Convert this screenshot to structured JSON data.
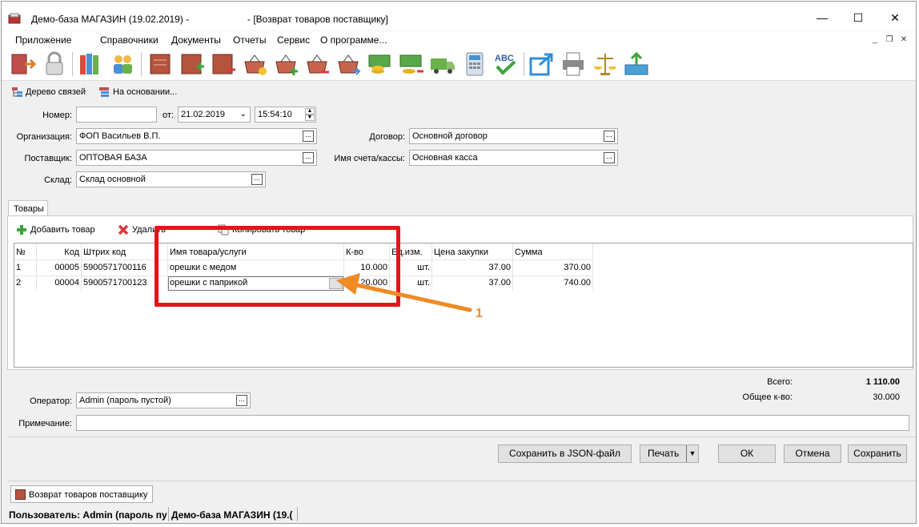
{
  "titlebar": {
    "app_title": "Демо-база МАГАЗИН (19.02.2019) -",
    "doc_title": "- [Возврат товаров поставщику]"
  },
  "menu": [
    "Приложение",
    "Справочники",
    "Документы",
    "Отчеты",
    "Сервис",
    "О программе..."
  ],
  "doc_toolbar": {
    "tree_label": "Дерево связей",
    "based_label": "На основании..."
  },
  "form": {
    "number_label": "Номер:",
    "number_value": "",
    "from_label": "от:",
    "date_value": "21.02.2019",
    "time_value": "15:54:10",
    "org_label": "Организация:",
    "org_value": "ФОП Васильев В.П.",
    "supplier_label": "Поставщик:",
    "supplier_value": "ОПТОВАЯ БАЗА",
    "warehouse_label": "Склад:",
    "warehouse_value": "Склад основной",
    "contract_label": "Договор:",
    "contract_value": "Основной договор",
    "account_label": "Имя счета/кассы:",
    "account_value": "Основная касса"
  },
  "tabs": {
    "goods": "Товары"
  },
  "grid_toolbar": {
    "add": "Добавить товар",
    "delete": "Удалить",
    "copy": "Копировать товар"
  },
  "grid": {
    "headers": [
      "№",
      "Код",
      "Штрих код",
      "Имя товара/услуги",
      "К-во",
      "Ед.изм.",
      "Цена закупки",
      "Сумма"
    ],
    "rows": [
      [
        "1",
        "00005",
        "5900571700116",
        "орешки с медом",
        "10.000",
        "шт.",
        "37.00",
        "370.00"
      ],
      [
        "2",
        "00004",
        "5900571700123",
        "орешки с паприкой",
        "20.000",
        "шт.",
        "37.00",
        "740.00"
      ]
    ]
  },
  "totals": {
    "total_label": "Всего:",
    "total_value": "1 110.00",
    "qty_label": "Общее к-во:",
    "qty_value": "30.000"
  },
  "footer": {
    "operator_label": "Оператор:",
    "operator_value": "Admin (пароль пустой)",
    "note_label": "Примечание:",
    "note_value": ""
  },
  "buttons": {
    "save_json": "Сохранить в JSON-файл",
    "print": "Печать",
    "ok": "ОК",
    "cancel": "Отмена",
    "save": "Сохранить"
  },
  "taskbar": {
    "doc_tab": "Возврат товаров поставщику"
  },
  "status": {
    "user": "Пользователь: Admin (пароль пусто",
    "base": "Демо-база МАГАЗИН (19.("
  },
  "annotation": {
    "number": "1",
    "highlight_color": "#e8131a",
    "arrow_color": "#f08a24"
  }
}
